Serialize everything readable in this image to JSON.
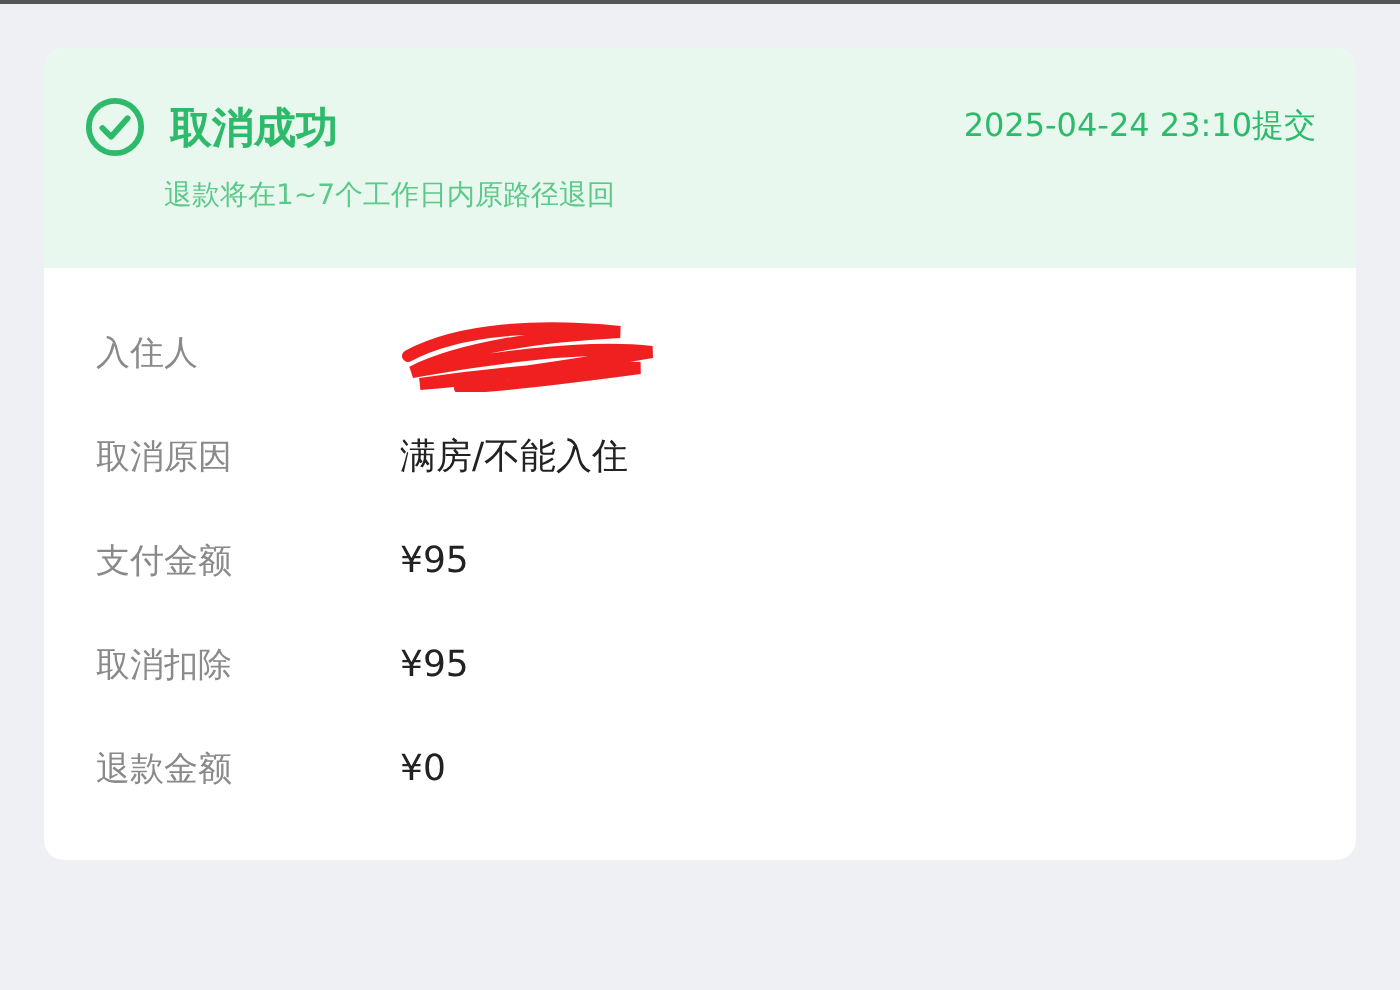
{
  "header": {
    "title": "取消成功",
    "time": "2025-04-24 23:10提交",
    "note": "退款将在1~7个工作日内原路径退回"
  },
  "rows": [
    {
      "kind": "redacted",
      "label": "入住人"
    },
    {
      "kind": "text",
      "label": "取消原因",
      "value": "满房/不能入住"
    },
    {
      "kind": "text",
      "label": "支付金额",
      "value": "¥95"
    },
    {
      "kind": "text",
      "label": "取消扣除",
      "value": "¥95"
    },
    {
      "kind": "text",
      "label": "退款金额",
      "value": "¥0"
    }
  ]
}
